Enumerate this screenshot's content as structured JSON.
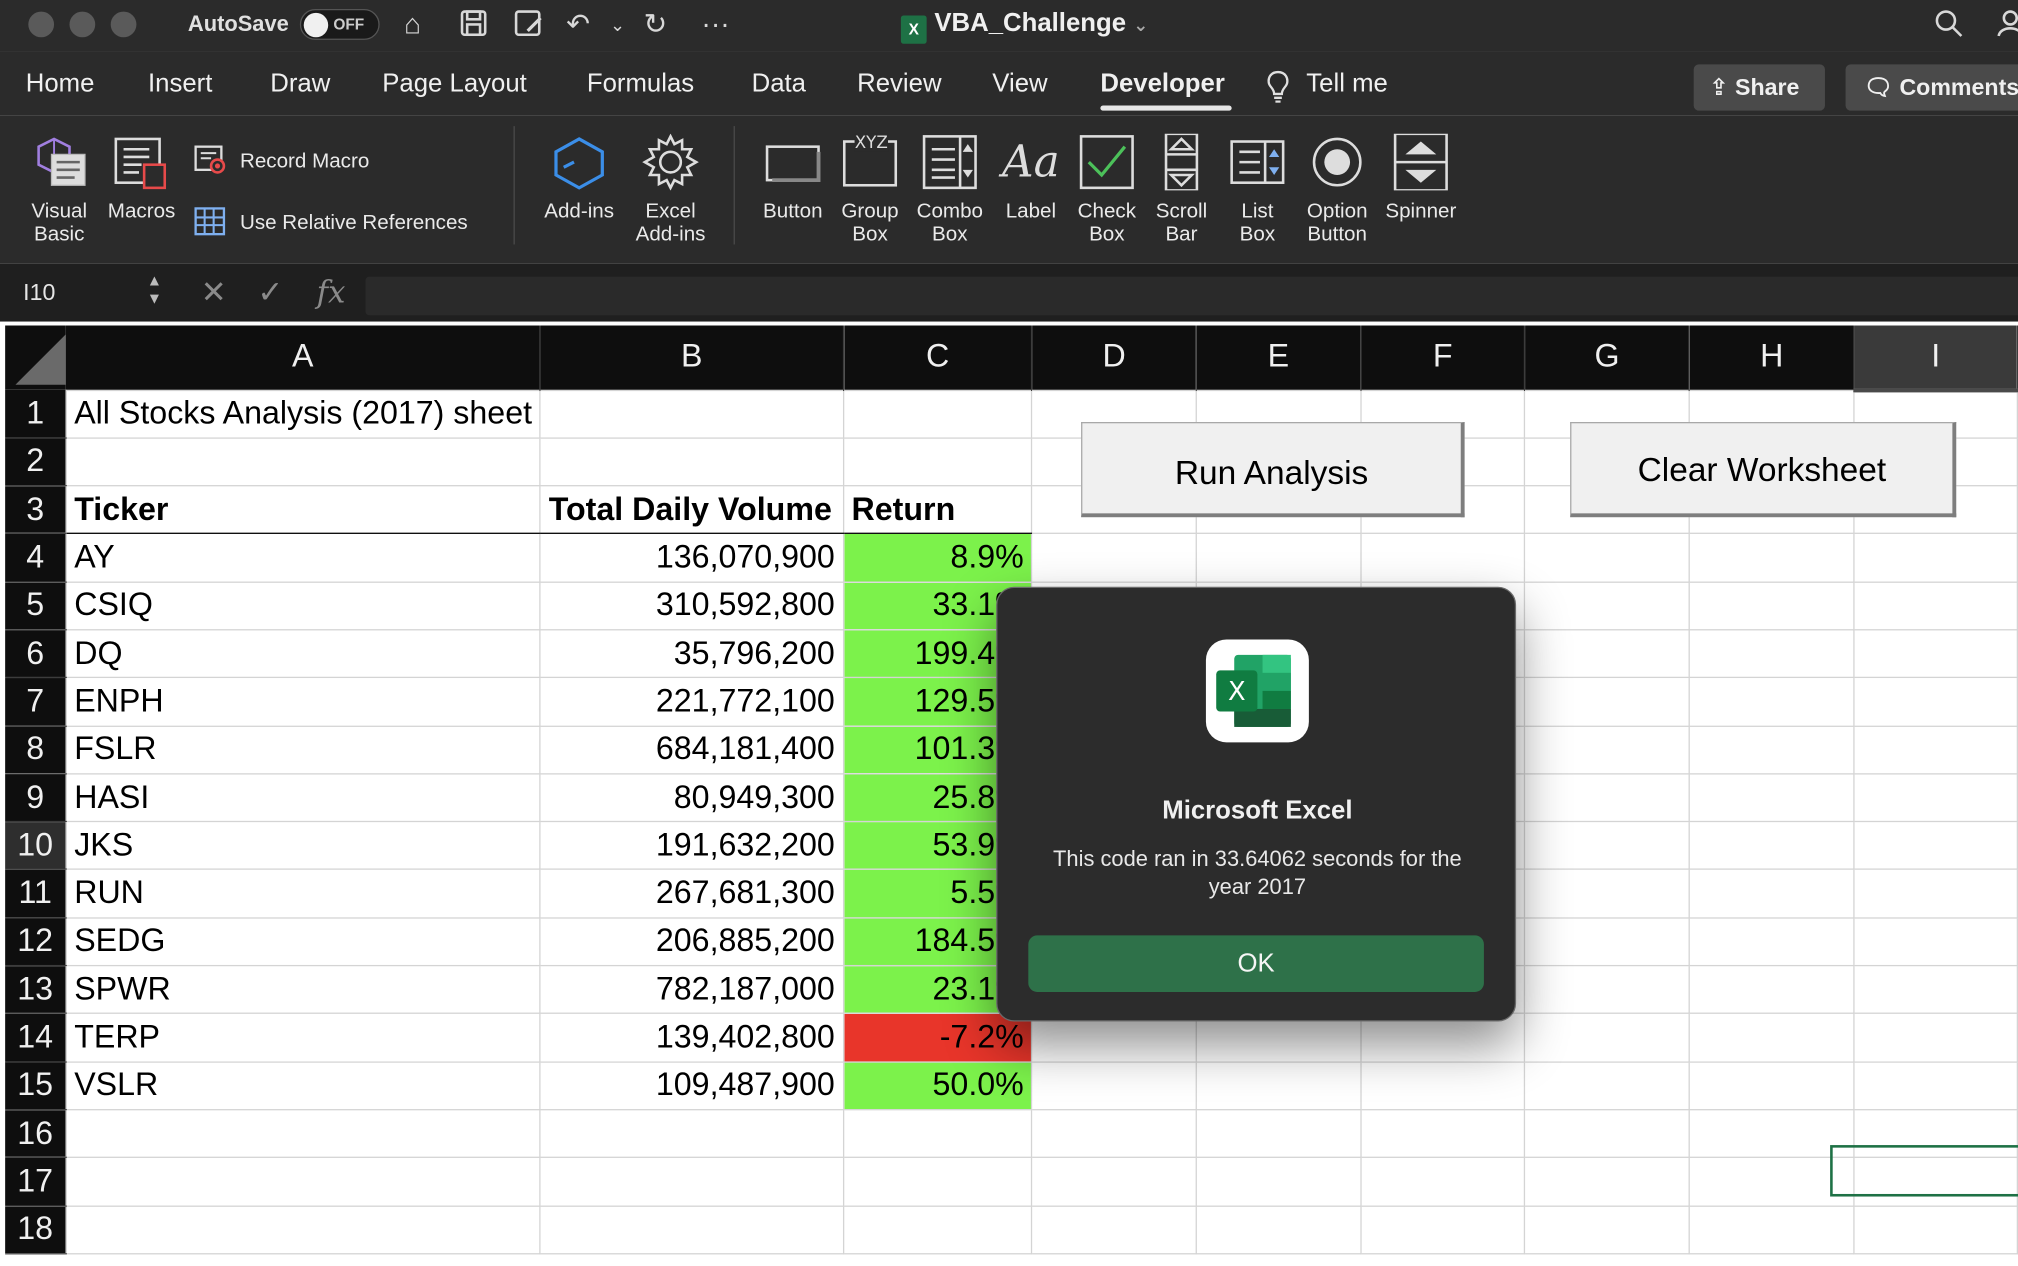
{
  "titlebar": {
    "autosave_label": "AutoSave",
    "autosave_state": "OFF",
    "document_title": "VBA_Challenge",
    "doc_icon_letter": "X"
  },
  "menu": {
    "items": [
      "Home",
      "Insert",
      "Draw",
      "Page Layout",
      "Formulas",
      "Data",
      "Review",
      "View",
      "Developer"
    ],
    "active": "Developer",
    "tell_me": "Tell me",
    "share": "Share",
    "comments": "Comments"
  },
  "ribbon": {
    "visual_basic": "Visual Basic",
    "macros": "Macros",
    "record_macro": "Record Macro",
    "use_relative_references": "Use Relative References",
    "add_ins": "Add-ins",
    "excel_add_ins": "Excel Add-ins",
    "button": "Button",
    "group_box": "Group Box",
    "group_box_icon_text": "XYZ",
    "combo_box": "Combo Box",
    "label": "Label",
    "label_icon_text": "Aa",
    "check_box": "Check Box",
    "scroll_bar": "Scroll Bar",
    "list_box": "List Box",
    "option_button": "Option Button",
    "spinner": "Spinner"
  },
  "formula_bar": {
    "name_box": "I10",
    "fx_label": "fx",
    "formula": ""
  },
  "columns": [
    "A",
    "B",
    "C",
    "D",
    "E",
    "F",
    "G",
    "H",
    "I"
  ],
  "selected_column": "I",
  "selected_row": 10,
  "sheet": {
    "title": "All Stocks Analysis (2017) sheet",
    "headers": [
      "Ticker",
      "Total Daily Volume",
      "Return"
    ],
    "rows": [
      {
        "ticker": "AY",
        "volume": "136,070,900",
        "return": "8.9%",
        "status": "positive"
      },
      {
        "ticker": "CSIQ",
        "volume": "310,592,800",
        "return": "33.1%",
        "status": "positive"
      },
      {
        "ticker": "DQ",
        "volume": "35,796,200",
        "return": "199.4%",
        "status": "positive"
      },
      {
        "ticker": "ENPH",
        "volume": "221,772,100",
        "return": "129.5%",
        "status": "positive"
      },
      {
        "ticker": "FSLR",
        "volume": "684,181,400",
        "return": "101.3%",
        "status": "positive"
      },
      {
        "ticker": "HASI",
        "volume": "80,949,300",
        "return": "25.8%",
        "status": "positive"
      },
      {
        "ticker": "JKS",
        "volume": "191,632,200",
        "return": "53.9%",
        "status": "positive"
      },
      {
        "ticker": "RUN",
        "volume": "267,681,300",
        "return": "5.5%",
        "status": "positive"
      },
      {
        "ticker": "SEDG",
        "volume": "206,885,200",
        "return": "184.5%",
        "status": "positive"
      },
      {
        "ticker": "SPWR",
        "volume": "782,187,000",
        "return": "23.1%",
        "status": "positive"
      },
      {
        "ticker": "TERP",
        "volume": "139,402,800",
        "return": "-7.2%",
        "status": "negative"
      },
      {
        "ticker": "VSLR",
        "volume": "109,487,900",
        "return": "50.0%",
        "status": "positive"
      }
    ],
    "row_numbers": [
      1,
      2,
      3,
      4,
      5,
      6,
      7,
      8,
      9,
      10,
      11,
      12,
      13,
      14,
      15,
      16,
      17,
      18
    ]
  },
  "buttons": {
    "run_analysis": "Run Analysis",
    "clear_worksheet": "Clear Worksheet"
  },
  "dialog": {
    "app_name": "Microsoft Excel",
    "message": "This code ran in 33.64062 seconds for the year 2017",
    "ok": "OK",
    "icon_letter": "X"
  },
  "colors": {
    "positive_fill": "#7cf24b",
    "negative_fill": "#e8352a",
    "excel_green": "#1e7145",
    "ok_button": "#2e7149"
  }
}
